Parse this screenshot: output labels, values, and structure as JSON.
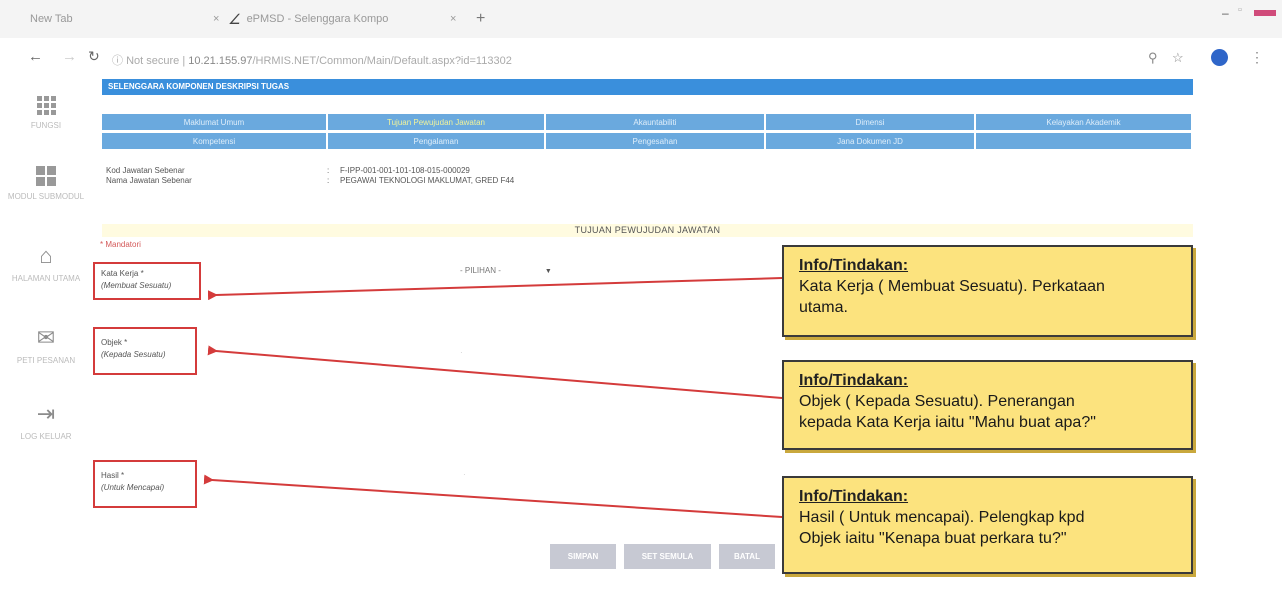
{
  "browser": {
    "tab1_label": "New Tab",
    "tab2_label": "ePMSD - Selenggara Kompo",
    "close_glyph": "×",
    "newtab_glyph": "+",
    "url_security": "Not secure",
    "url_host": "10.21.155.97",
    "url_path": "/HRMIS.NET/Common/Main/Default.aspx?id=113302"
  },
  "sidebar": {
    "items": [
      {
        "label": "FUNGSI",
        "icon": "apps-grid-icon"
      },
      {
        "label": "MODUL SUBMODUL",
        "icon": "modules-icon"
      },
      {
        "label": "HALAMAN UTAMA",
        "icon": "home-icon"
      },
      {
        "label": "PETI PESANAN",
        "icon": "mail-icon"
      },
      {
        "label": "LOG KELUAR",
        "icon": "logout-icon"
      }
    ]
  },
  "page": {
    "header": "SELENGGARA KOMPONEN DESKRIPSI TUGAS",
    "menu_row1": [
      "Maklumat Umum",
      "Tujuan Pewujudan Jawatan",
      "Akauntabiliti",
      "Dimensi",
      "Kelayakan Akademik"
    ],
    "menu_row2": [
      "Kompetensi",
      "Pengalaman",
      "Pengesahan",
      "Jana Dokumen JD",
      ""
    ],
    "kod_label": "Kod Jawatan Sebenar",
    "kod_value": "F-IPP-001-001-101-108-015-000029",
    "nama_label": "Nama Jawatan Sebenar",
    "nama_value": "PEGAWAI TEKNOLOGI MAKLUMAT, GRED F44",
    "colon": ":",
    "section_title": "TUJUAN PEWUJUDAN JAWATAN",
    "mandatori": "* Mandatori",
    "fields": [
      {
        "label": "Kata Kerja *",
        "sub": "(Membuat Sesuatu)"
      },
      {
        "label": "Objek *",
        "sub": "(Kepada Sesuatu)"
      },
      {
        "label": "Hasil *",
        "sub": "(Untuk Mencapai)"
      }
    ],
    "select_value": "- PILIHAN -",
    "buttons": [
      "SIMPAN",
      "SET SEMULA",
      "BATAL"
    ]
  },
  "callouts": [
    {
      "title": "Info/Tindakan:",
      "line1": "Kata Kerja ( Membuat Sesuatu). Perkataan",
      "line2": "utama."
    },
    {
      "title": "Info/Tindakan:",
      "line1": "Objek ( Kepada Sesuatu). Penerangan",
      "line2": "kepada Kata Kerja iaitu \"Mahu buat apa?\""
    },
    {
      "title": "Info/Tindakan:",
      "line1": "Hasil ( Untuk mencapai). Pelengkap kpd",
      "line2": "Objek iaitu \"Kenapa buat perkara tu?\""
    }
  ],
  "colors": {
    "accent": "#3a8fdc",
    "callout": "#fce37e",
    "arrow": "#d43b3b"
  }
}
